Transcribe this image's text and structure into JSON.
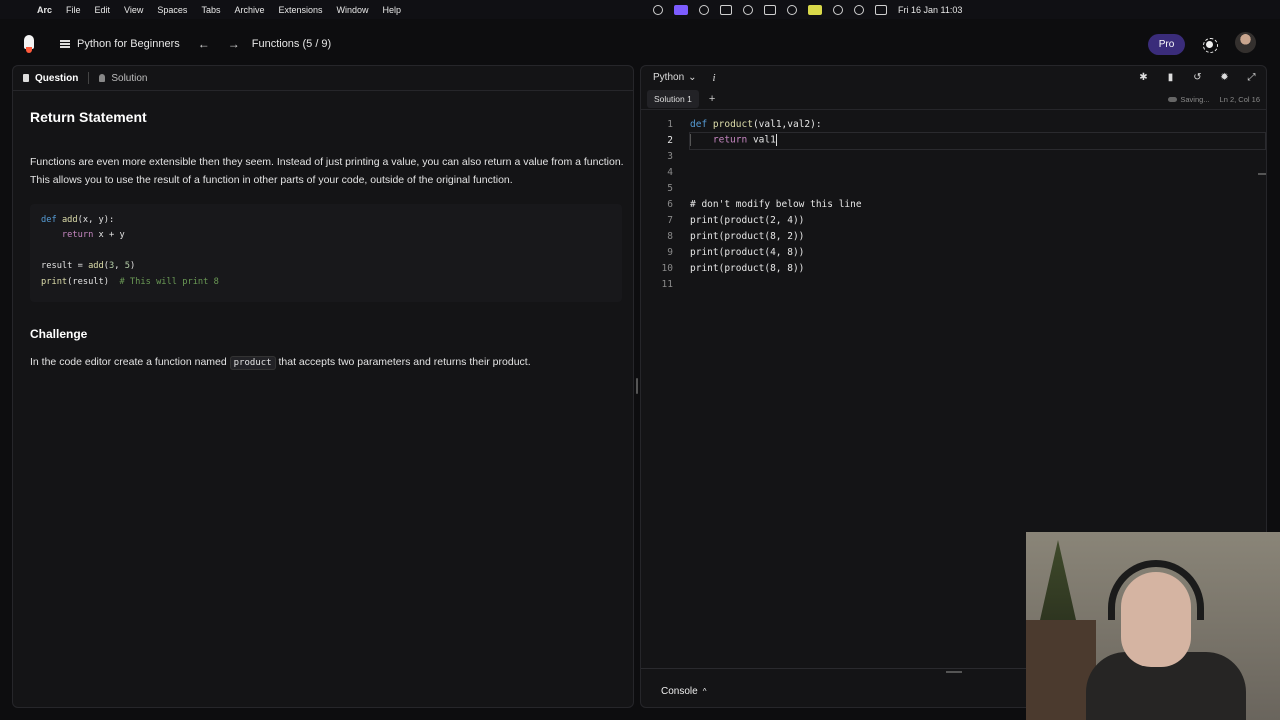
{
  "menubar": {
    "app": "Arc",
    "items": [
      "File",
      "Edit",
      "View",
      "Spaces",
      "Tabs",
      "Archive",
      "Extensions",
      "Window",
      "Help"
    ],
    "datetime": "Fri 16 Jan  11:03"
  },
  "topbar": {
    "course": "Python for Beginners",
    "lesson": "Functions (5 / 9)",
    "pro": "Pro"
  },
  "left": {
    "tabs": {
      "question": "Question",
      "solution": "Solution"
    },
    "title": "Return Statement",
    "paragraph": "Functions are even more extensible then they seem. Instead of just printing a value, you can also return a value from a function. This allows you to use the result of a function in other parts of your code, outside of the original function.",
    "example": {
      "l1_kw": "def",
      "l1_fn": "add",
      "l1_rest": "(x, y):",
      "l2_indent": "    ",
      "l2_kw": "return",
      "l2_rest": " x + y",
      "l4_a": "result = ",
      "l4_fn": "add",
      "l4_p": "(",
      "l4_n1": "3",
      "l4_c": ", ",
      "l4_n2": "5",
      "l4_e": ")",
      "l5_fn": "print",
      "l5_rest": "(result)  ",
      "l5_cm": "# This will print 8"
    },
    "challenge_title": "Challenge",
    "challenge_pre": "In the code editor create a function named ",
    "challenge_code": "product",
    "challenge_post": " that accepts two parameters and returns their product."
  },
  "editor": {
    "language": "Python",
    "info": "i",
    "solution_tab": "Solution 1",
    "add": "+",
    "saving": "Saving...",
    "position": "Ln 2, Col 16",
    "lines": [
      {
        "n": "1",
        "text": "def product(val1,val2):"
      },
      {
        "n": "2",
        "text": "    return val1"
      },
      {
        "n": "3",
        "text": ""
      },
      {
        "n": "4",
        "text": ""
      },
      {
        "n": "5",
        "text": ""
      },
      {
        "n": "6",
        "text": "# don't modify below this line"
      },
      {
        "n": "7",
        "text": "print(product(2, 4))"
      },
      {
        "n": "8",
        "text": "print(product(8, 2))"
      },
      {
        "n": "9",
        "text": "print(product(4, 8))"
      },
      {
        "n": "10",
        "text": "print(product(8, 8))"
      },
      {
        "n": "11",
        "text": ""
      }
    ],
    "console": "Console"
  }
}
